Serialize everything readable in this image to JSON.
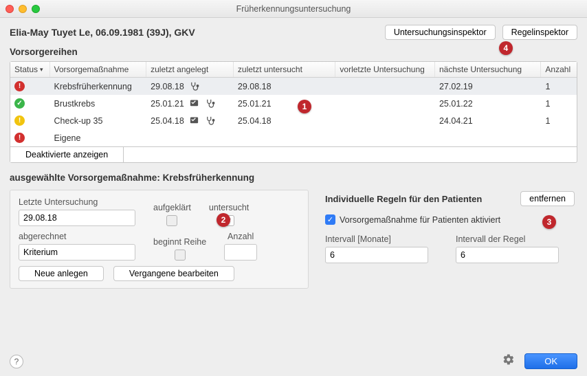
{
  "window": {
    "title": "Früherkennungsuntersuchung"
  },
  "patient": {
    "display": "Elia-May Tuyet Le, 06.09.1981 (39J), GKV"
  },
  "header": {
    "inspector": "Untersuchungsinspektor",
    "rules": "Regelinspektor"
  },
  "table": {
    "title": "Vorsorgereihen",
    "cols": {
      "status": "Status",
      "name": "Vorsorgemaßnahme",
      "created": "zuletzt angelegt",
      "examined": "zuletzt untersucht",
      "prev": "vorletzte Untersuchung",
      "next": "nächste Untersuchung",
      "count": "Anzahl"
    },
    "rows": [
      {
        "status": "red",
        "glyph": "!",
        "name": "Krebsfrüherkennung",
        "created": "29.08.18",
        "has_note": false,
        "has_exam": true,
        "examined": "29.08.18",
        "next": "27.02.19",
        "count": "1",
        "selected": true
      },
      {
        "status": "green",
        "glyph": "✓",
        "name": "Brustkrebs",
        "created": "25.01.21",
        "has_note": true,
        "has_exam": true,
        "examined": "25.01.21",
        "next": "25.01.22",
        "count": "1",
        "selected": false
      },
      {
        "status": "yellow",
        "glyph": "!",
        "name": "Check-up 35",
        "created": "25.04.18",
        "has_note": true,
        "has_exam": true,
        "examined": "25.04.18",
        "next": "24.04.21",
        "count": "1",
        "selected": false
      },
      {
        "status": "red",
        "glyph": "!",
        "name": "Eigene",
        "created": "",
        "has_note": false,
        "has_exam": false,
        "examined": "",
        "next": "",
        "count": "",
        "selected": false
      }
    ],
    "show_deactivated": "Deaktivierte anzeigen"
  },
  "selected": {
    "prefix": "ausgewählte Vorsorgemaßnahme: ",
    "name": "Krebsfrüherkennung"
  },
  "left_panel": {
    "last_exam_label": "Letzte Untersuchung",
    "last_exam_value": "29.08.18",
    "informed_label": "aufgeklärt",
    "examined_label": "untersucht",
    "billed_label": "abgerechnet",
    "billed_value": "Kriterium",
    "begins_label": "beginnt Reihe",
    "count_label": "Anzahl",
    "count_value": "",
    "new_btn": "Neue anlegen",
    "edit_btn": "Vergangene bearbeiten"
  },
  "right_panel": {
    "title": "Individuelle Regeln für den Patienten",
    "remove_btn": "entfernen",
    "activate_label": "Vorsorgemaßnahme für Patienten aktiviert",
    "interval_label": "Intervall [Monate]",
    "interval_value": "6",
    "rule_interval_label": "Intervall der Regel",
    "rule_interval_value": "6"
  },
  "footer": {
    "help": "?",
    "ok": "OK"
  },
  "badges": {
    "b1": "1",
    "b2": "2",
    "b3": "3",
    "b4": "4"
  }
}
